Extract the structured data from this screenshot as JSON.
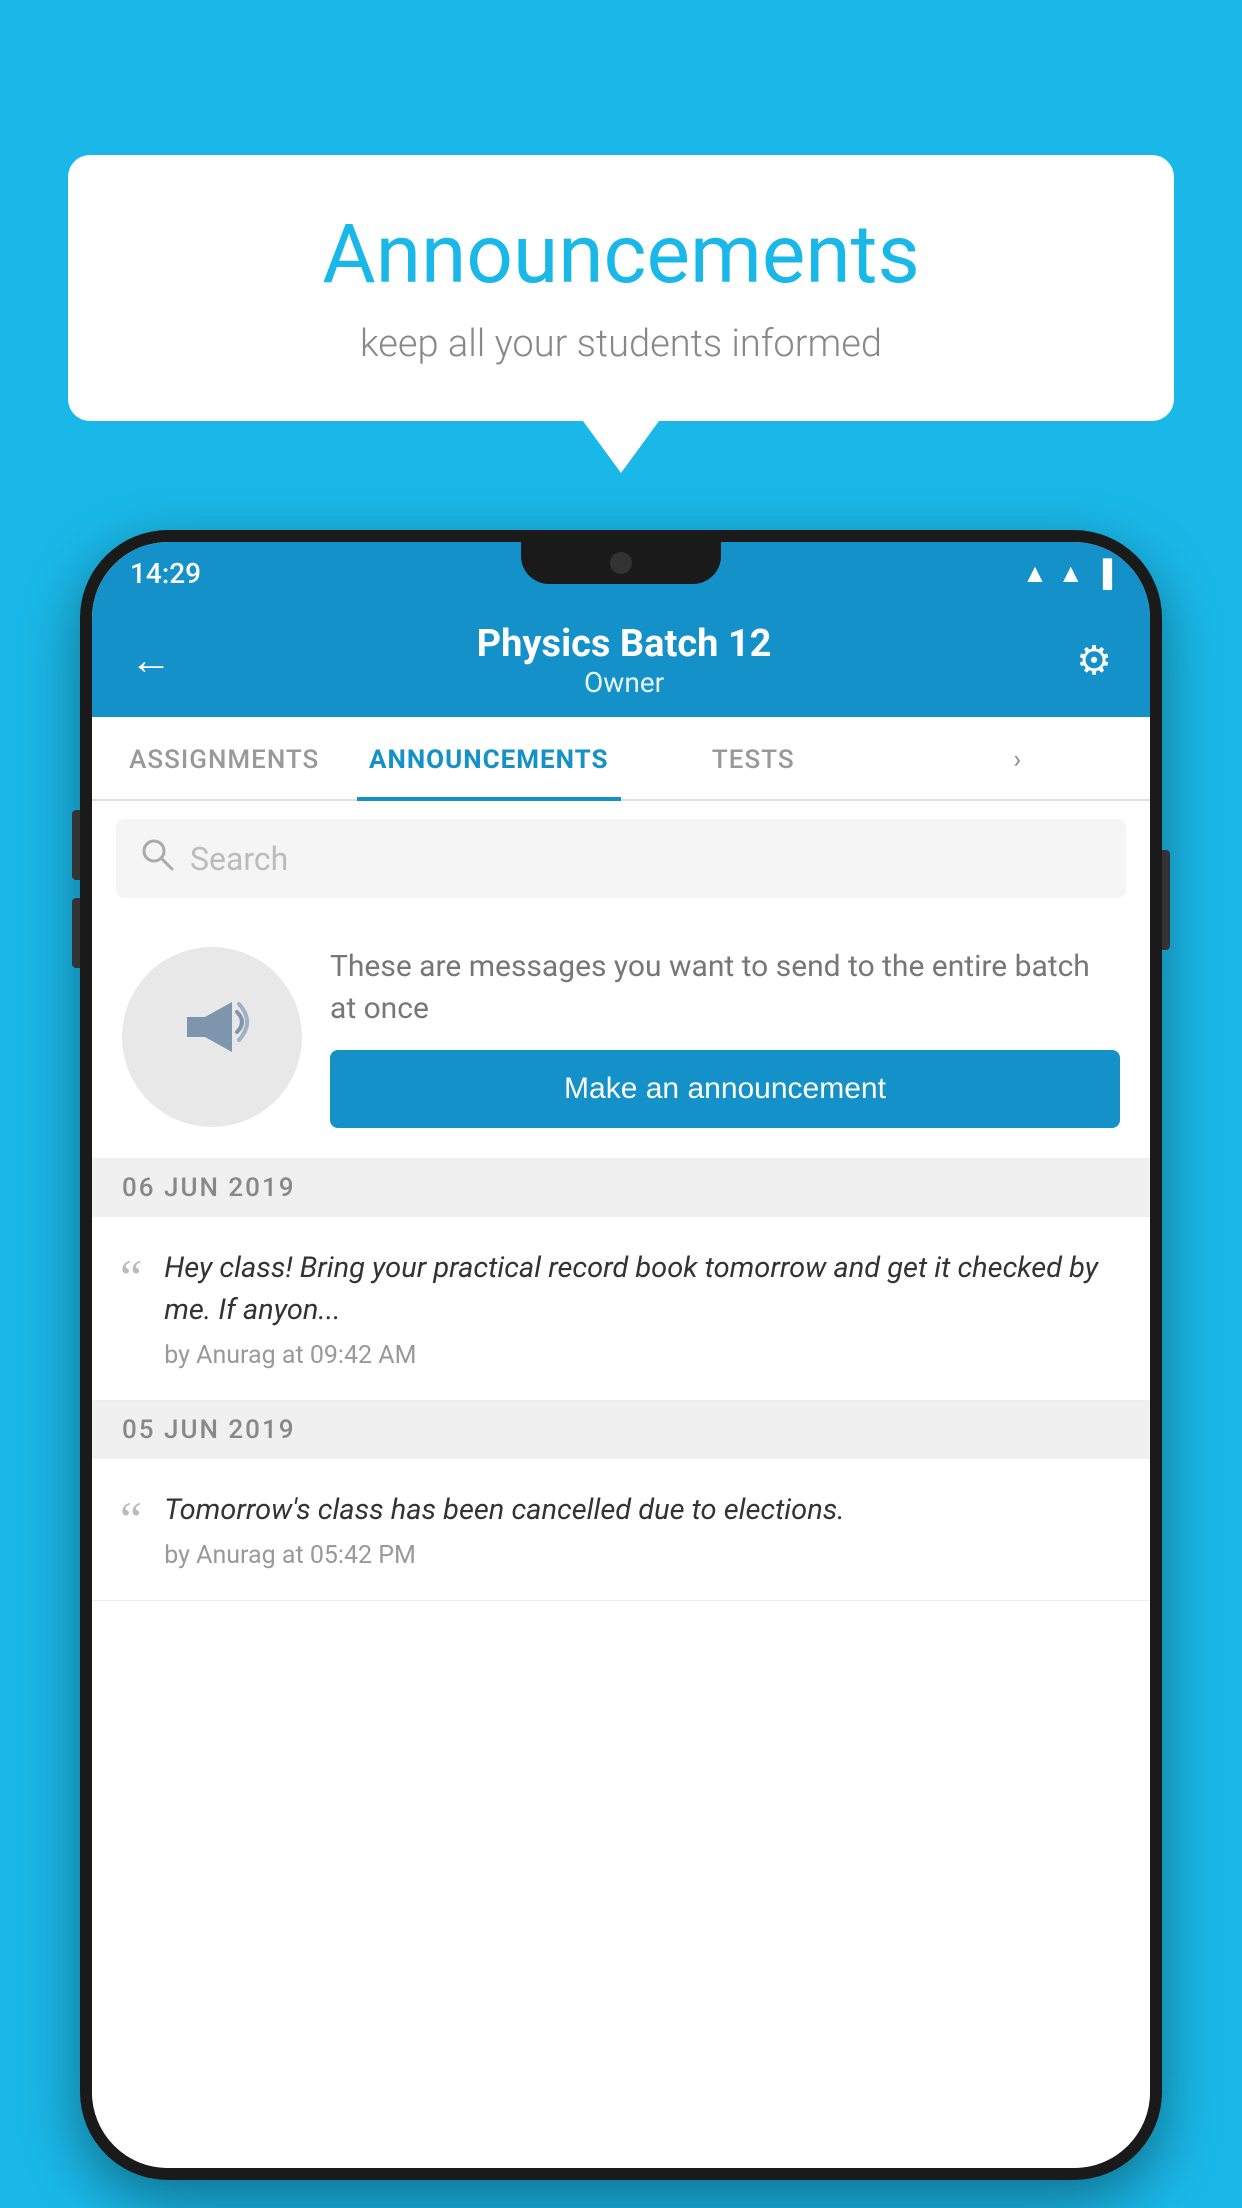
{
  "background_color": "#1ab8e8",
  "speech_bubble": {
    "title": "Announcements",
    "subtitle": "keep all your students informed"
  },
  "phone": {
    "status_bar": {
      "time": "14:29",
      "wifi": "▲",
      "signal": "▲",
      "battery": "▌"
    },
    "header": {
      "back_label": "←",
      "title": "Physics Batch 12",
      "subtitle": "Owner",
      "settings_label": "⚙"
    },
    "tabs": [
      {
        "label": "ASSIGNMENTS",
        "active": false
      },
      {
        "label": "ANNOUNCEMENTS",
        "active": true
      },
      {
        "label": "TESTS",
        "active": false
      },
      {
        "label": "›",
        "active": false
      }
    ],
    "search": {
      "placeholder": "Search"
    },
    "announcement_prompt": {
      "description_text": "These are messages you want to send to the entire batch at once",
      "button_label": "Make an announcement"
    },
    "announcements": [
      {
        "date": "06  JUN  2019",
        "text": "Hey class! Bring your practical record book tomorrow and get it checked by me. If anyon...",
        "meta": "by Anurag at 09:42 AM"
      },
      {
        "date": "05  JUN  2019",
        "text": "Tomorrow's class has been cancelled due to elections.",
        "meta": "by Anurag at 05:42 PM"
      }
    ]
  }
}
